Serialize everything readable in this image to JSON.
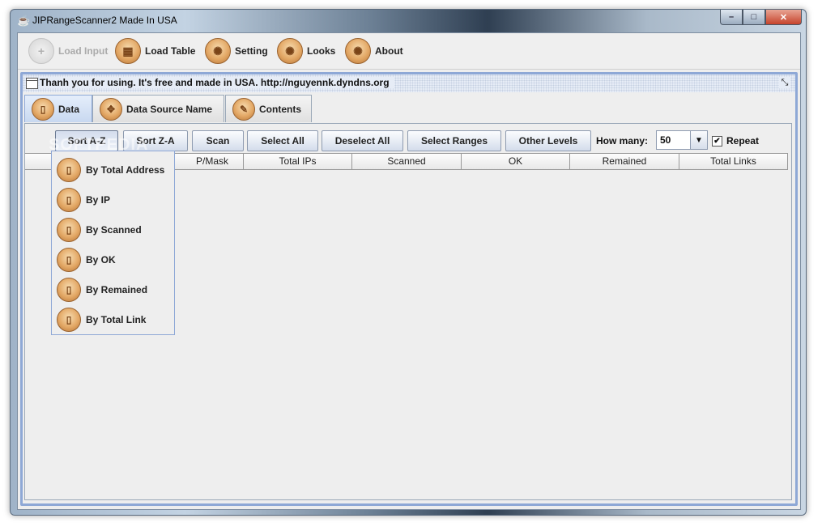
{
  "window": {
    "title": "JIPRangeScanner2 Made In USA",
    "minimize_glyph": "–",
    "maximize_glyph": "□",
    "close_glyph": "✕"
  },
  "toolbar": {
    "items": [
      {
        "label": "Load Input",
        "icon": "plus-icon",
        "enabled": false
      },
      {
        "label": "Load Table",
        "icon": "table-icon",
        "enabled": true
      },
      {
        "label": "Setting",
        "icon": "gear-icon",
        "enabled": true
      },
      {
        "label": "Looks",
        "icon": "gear-icon",
        "enabled": true
      },
      {
        "label": "About",
        "icon": "gear-icon",
        "enabled": true
      }
    ]
  },
  "internal_frame": {
    "title": "Thanh you for using. It's free and made in USA. http://nguyennk.dyndns.org"
  },
  "tabs": [
    {
      "label": "Data",
      "icon": "document-icon",
      "active": true
    },
    {
      "label": "Data Source Name",
      "icon": "gamepad-icon",
      "active": false
    },
    {
      "label": "Contents",
      "icon": "pencil-icon",
      "active": false
    }
  ],
  "actions": {
    "sort_az": "Sort A-Z",
    "sort_za": "Sort Z-A",
    "scan": "Scan",
    "select_all": "Select All",
    "deselect_all": "Deselect All",
    "select_ranges": "Select Ranges",
    "other_levels": "Other Levels",
    "how_many_label": "How many:",
    "how_many_value": "50",
    "repeat_label": "Repeat",
    "repeat_checked": true
  },
  "table": {
    "columns": [
      "",
      "IP/Mask",
      "Total IPs",
      "Scanned",
      "OK",
      "Remained",
      "Total Links"
    ],
    "visible_header_fragment": "P/Mask"
  },
  "sort_menu": {
    "items": [
      "By Total Address",
      "By IP",
      "By Scanned",
      "By OK",
      "By Remained",
      "By Total Link"
    ]
  },
  "watermark": "SOFTPEDIA",
  "colors": {
    "accent_blue": "#8ea8d6",
    "icon_orange": "#e3a866",
    "close_red": "#c6432b"
  }
}
